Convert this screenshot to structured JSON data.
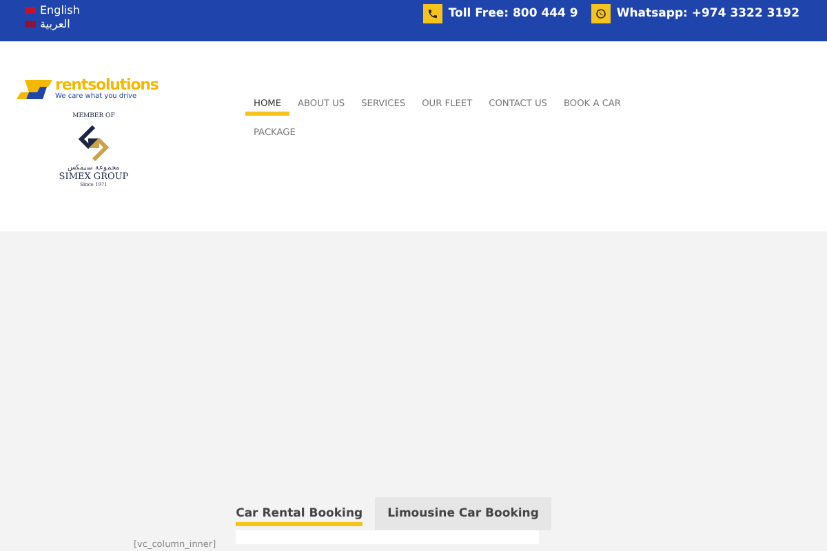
{
  "languages": [
    {
      "label": "English",
      "color": "#c8102e"
    },
    {
      "label": "العربية",
      "color": "#8a1538"
    }
  ],
  "contacts": [
    {
      "kind": "phone",
      "label": "Toll Free: 800 444 9"
    },
    {
      "kind": "whatsapp",
      "label": "Whatsapp: +974 3322 3192"
    }
  ],
  "logo": {
    "name": "rentsolutions",
    "tagline": "We care what you drive"
  },
  "member": {
    "heading": "MEMBER OF",
    "arabic": "مجموعة سيمكس",
    "name": "SIMEX GROUP",
    "since": "Since 1971"
  },
  "nav": [
    {
      "label": "HOME",
      "selected": true
    },
    {
      "label": "ABOUT US",
      "selected": false
    },
    {
      "label": "SERVICES",
      "selected": false
    },
    {
      "label": "OUR FLEET",
      "selected": false
    },
    {
      "label": "CONTACT US",
      "selected": false
    },
    {
      "label": "BOOK A CAR",
      "selected": false
    },
    {
      "label": "PACKAGE",
      "selected": false
    }
  ],
  "booking_tabs": [
    {
      "label": "Car Rental Booking",
      "selected": true
    },
    {
      "label": "Limousine Car Booking",
      "selected": false
    }
  ],
  "shortcode_text": "[vc_column_inner]"
}
